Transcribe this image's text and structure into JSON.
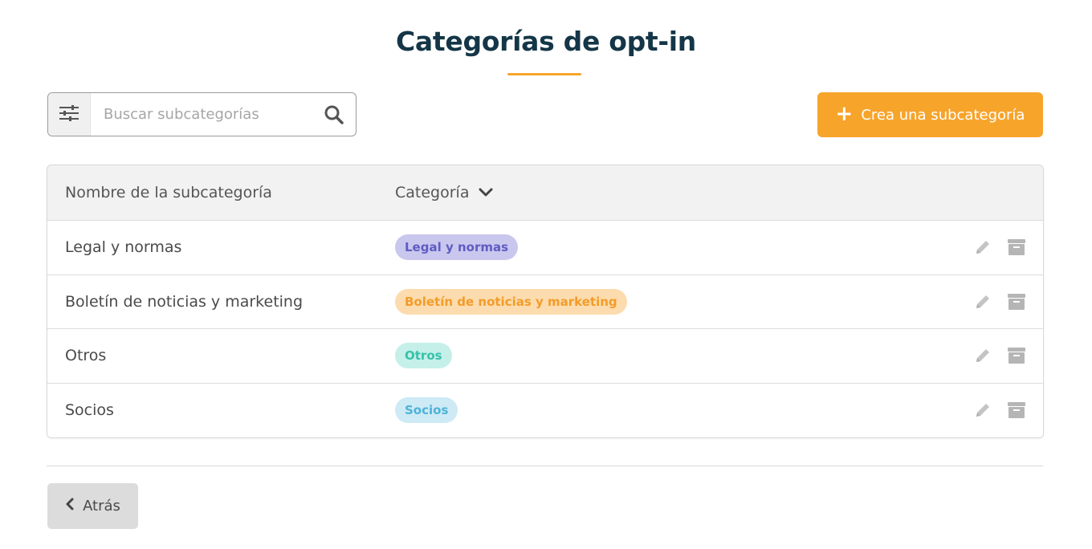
{
  "header": {
    "title": "Categorías de opt-in"
  },
  "colors": {
    "accent": "#f7a42b",
    "title": "#143647",
    "header_bg": "#f2f2f2"
  },
  "toolbar": {
    "filter_icon": "sliders-icon",
    "search_placeholder": "Buscar subcategorías",
    "search_value": "",
    "search_icon": "search-icon",
    "create_label": "Crea una subcategoría",
    "create_icon": "plus-icon"
  },
  "table": {
    "columns": [
      {
        "label": "Nombre de la subcategoría"
      },
      {
        "label": "Categoría",
        "icon": "chevron-down-icon"
      }
    ],
    "rows": [
      {
        "name": "Legal y normas",
        "category": "Legal y normas",
        "badge_bg": "#c9c7ee",
        "badge_fg": "#5f5cc2"
      },
      {
        "name": "Boletín de noticias y marketing",
        "category": "Boletín de noticias y marketing",
        "badge_bg": "#fcdcae",
        "badge_fg": "#f39c29"
      },
      {
        "name": "Otros",
        "category": "Otros",
        "badge_bg": "#c5f0e9",
        "badge_fg": "#36c2aa"
      },
      {
        "name": "Socios",
        "category": "Socios",
        "badge_bg": "#cdeaf5",
        "badge_fg": "#4db3d8"
      }
    ],
    "row_actions": [
      "pencil-icon",
      "archive-icon"
    ]
  },
  "footer": {
    "back_label": "Atrás",
    "back_icon": "chevron-left-icon"
  }
}
